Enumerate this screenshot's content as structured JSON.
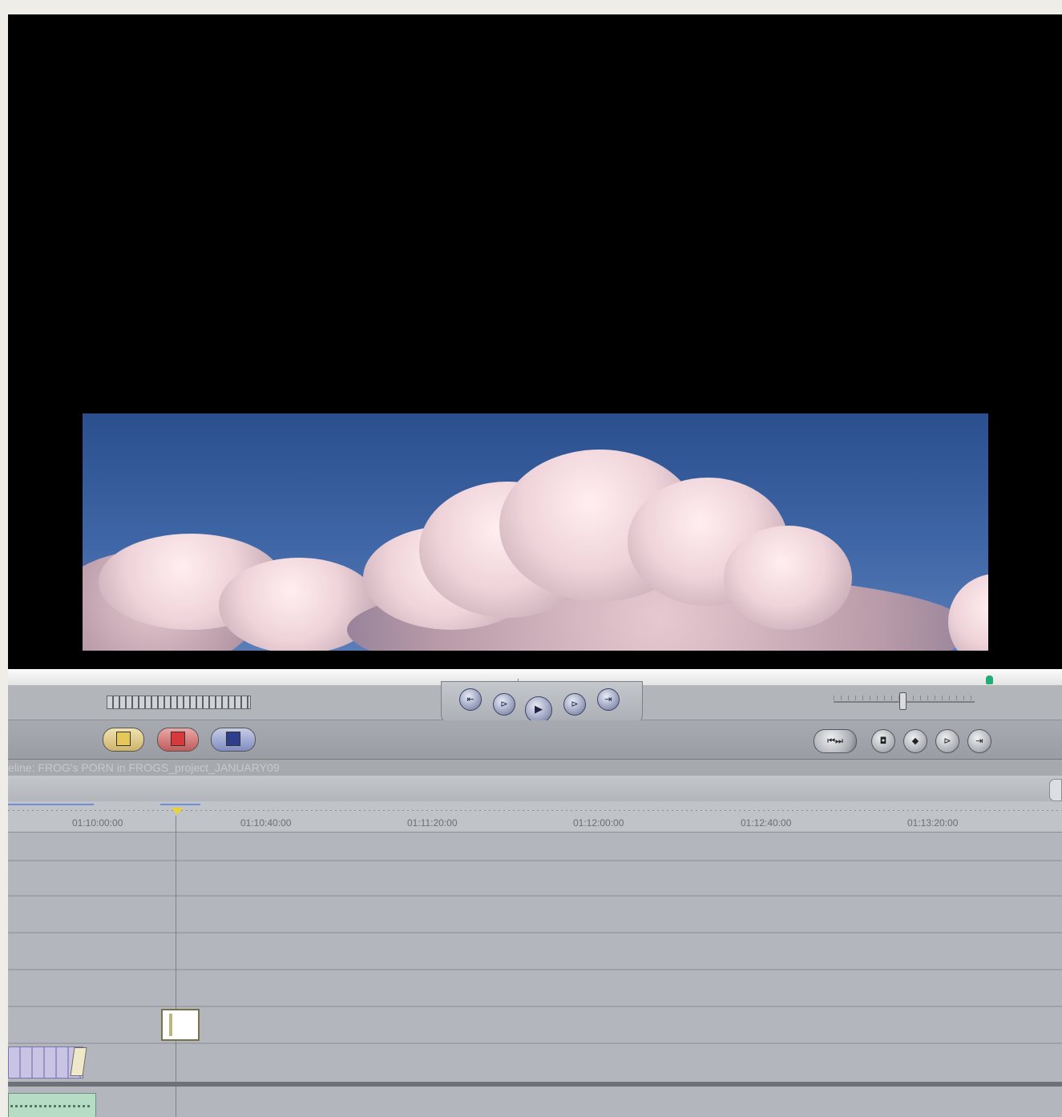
{
  "timeline": {
    "title": "eline: FROG's PORN in FROGS_project_JANUARY09",
    "timecodes": [
      "01:10:00:00",
      "01:10:40:00",
      "01:11:20:00",
      "01:12:00:00",
      "01:12:40:00",
      "01:13:20:00"
    ]
  },
  "transport": {
    "buttons": [
      "prev-edit-icon",
      "play-in-to-out-icon",
      "play-icon",
      "play-around-icon",
      "next-edit-icon"
    ]
  },
  "colors": {
    "playhead": "#e7d23a",
    "scrub_head": "#1fae73",
    "sky": "#3f66a6"
  }
}
